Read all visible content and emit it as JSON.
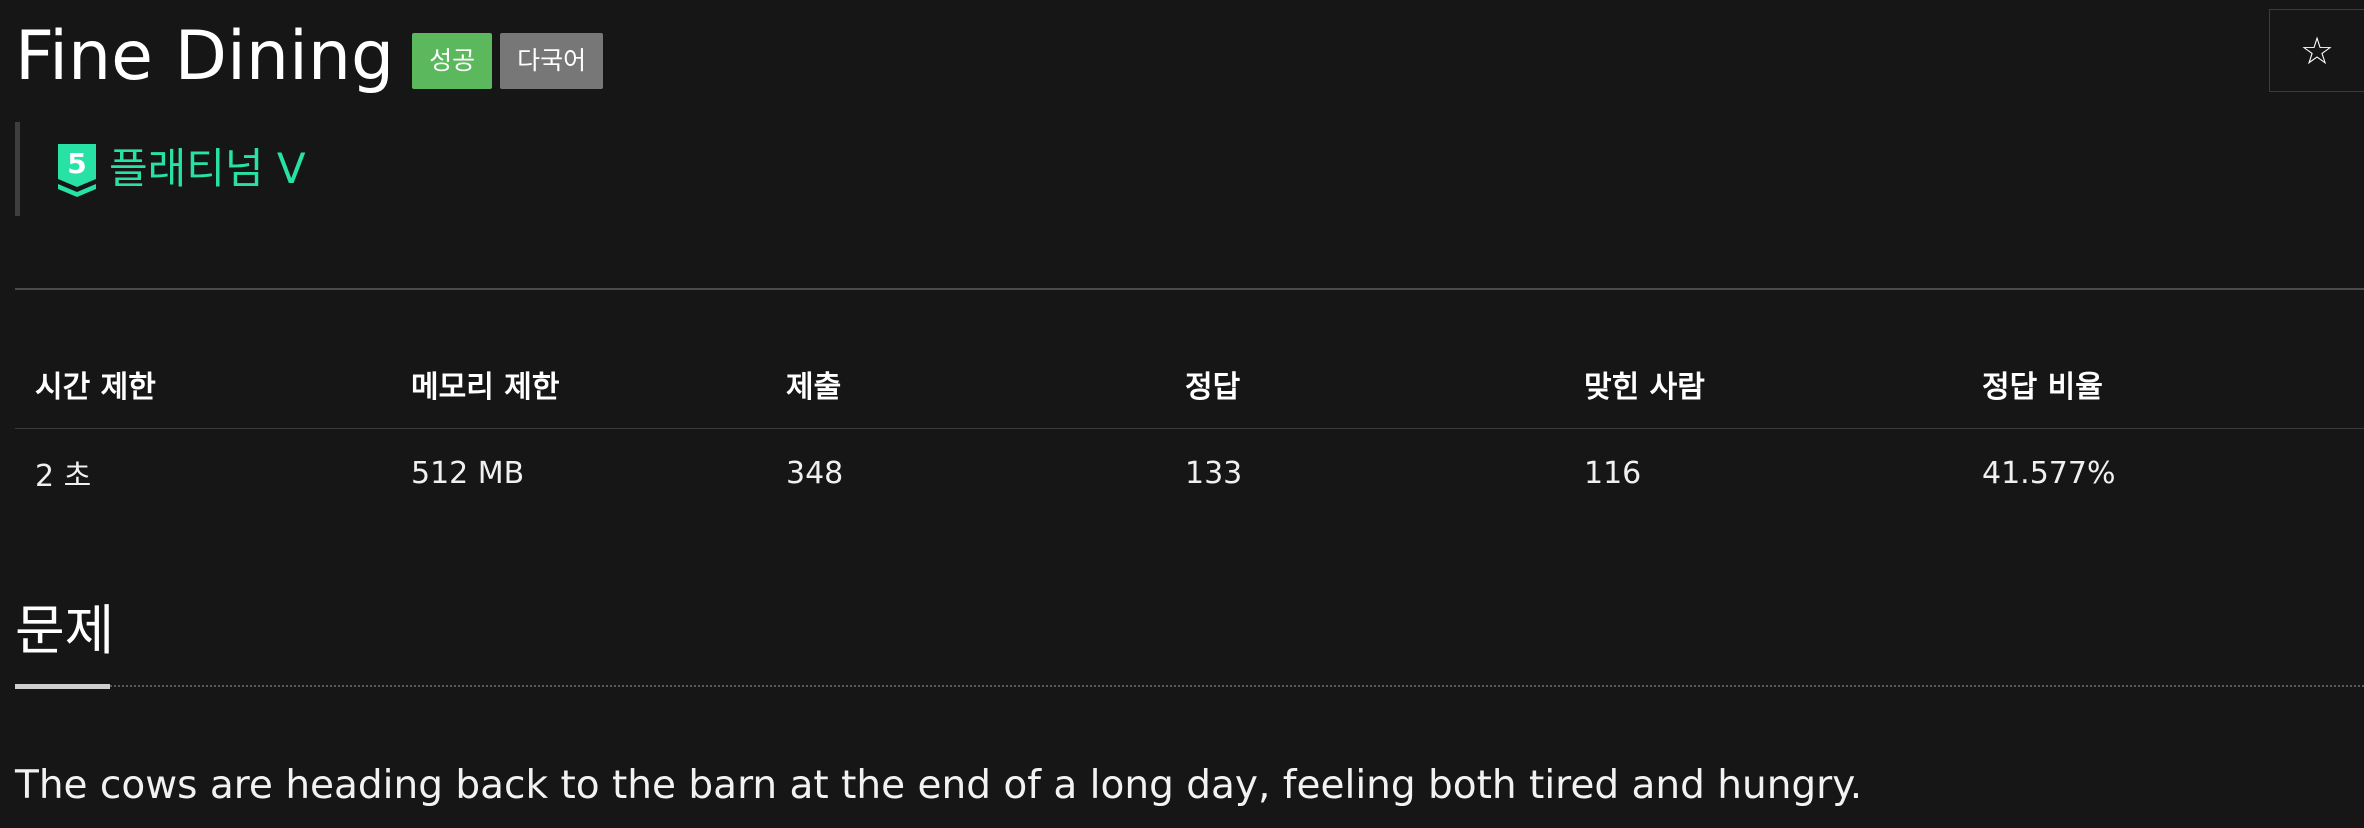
{
  "problem": {
    "title": "Fine Dining",
    "badges": {
      "status": "성공",
      "language": "다국어"
    },
    "favorite_icon": "☆",
    "tier": {
      "icon_number": "5",
      "label": "플래티넘 V",
      "color": "#27e2a4"
    }
  },
  "info_table": {
    "headers": [
      "시간 제한",
      "메모리 제한",
      "제출",
      "정답",
      "맞힌 사람",
      "정답 비율"
    ],
    "values": [
      "2 초",
      "512 MB",
      "348",
      "133",
      "116",
      "41.577%"
    ]
  },
  "section": {
    "title": "문제",
    "description": "The cows are heading back to the barn at the end of a long day, feeling both tired and hungry."
  },
  "colors": {
    "background": "#161616",
    "success_badge": "#5cb85c",
    "language_badge": "#777777",
    "tier_color": "#27e2a4"
  }
}
